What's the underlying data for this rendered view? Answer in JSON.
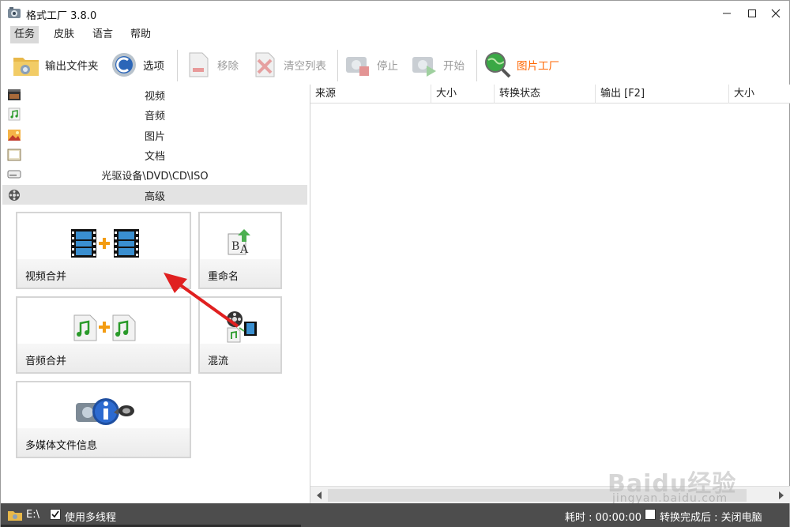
{
  "window": {
    "title": "格式工厂 3.8.0"
  },
  "menu": [
    "任务",
    "皮肤",
    "语言",
    "帮助"
  ],
  "toolbar": {
    "output_folder": "输出文件夹",
    "options": "选项",
    "remove": "移除",
    "clear_list": "清空列表",
    "stop": "停止",
    "start": "开始",
    "picture_factory": "图片工厂"
  },
  "categories": [
    "视频",
    "音频",
    "图片",
    "文档",
    "光驱设备\\DVD\\CD\\ISO",
    "高级"
  ],
  "tiles": {
    "video_merge": "视频合并",
    "rename": "重命名",
    "audio_merge": "音频合并",
    "mux": "混流",
    "media_info": "多媒体文件信息"
  },
  "columns": [
    "来源",
    "大小",
    "转换状态",
    "输出 [F2]",
    "大小"
  ],
  "status": {
    "drive": "E:\\",
    "multithread": "使用多线程",
    "elapsed": "耗时 : 00:00:00",
    "shutdown": "转换完成后 : 关闭电脑"
  },
  "watermark": {
    "brand": "Baidu经验",
    "url": "jingyan.baidu.com"
  },
  "colors": {
    "accent_orange": "#ff6600",
    "annotation_red": "#e02020",
    "status_bar": "#4d4d4d"
  }
}
